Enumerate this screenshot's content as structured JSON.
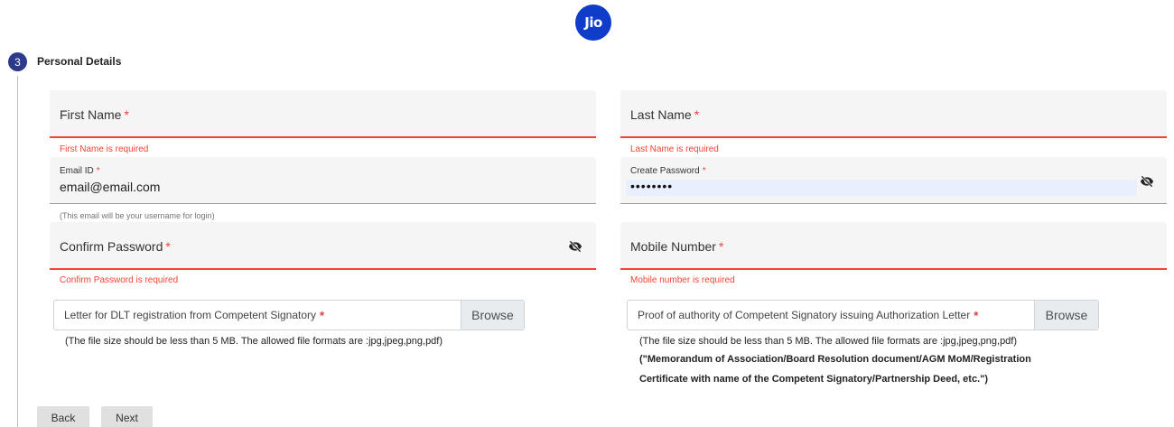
{
  "logo": {
    "text": "Jio"
  },
  "step": {
    "number": "3",
    "title": "Personal Details"
  },
  "form": {
    "first_name": {
      "label": "First Name",
      "required": "*",
      "error": "First Name is required"
    },
    "last_name": {
      "label": "Last Name",
      "required": "*",
      "error": "Last Name is required"
    },
    "email": {
      "label": "Email ID",
      "required": "*",
      "value": "email@email.com",
      "hint": "(This email will be your username for login)"
    },
    "create_password": {
      "label": "Create Password",
      "required": "*",
      "value": "••••••••"
    },
    "confirm_password": {
      "label": "Confirm Password",
      "required": "*",
      "error": "Confirm Password is required"
    },
    "mobile": {
      "label": "Mobile Number",
      "required": "*",
      "error": "Mobile number is required"
    }
  },
  "uploads": {
    "left": {
      "label": "Letter for DLT registration from Competent Signatory",
      "required": "*",
      "button": "Browse",
      "note": "(The file size should be less than 5 MB. The allowed file formats are :jpg,jpeg,png,pdf)"
    },
    "right": {
      "label": "Proof of authority of Competent Signatory issuing Authorization Letter",
      "required": "*",
      "button": "Browse",
      "note": "(The file size should be less than 5 MB. The allowed file formats are :jpg,jpeg,png,pdf)",
      "note_bold_1": "(\"Memorandum of Association/Board Resolution document/AGM MoM/Registration",
      "note_bold_2": "Certificate with name of the Competent Signatory/Partnership Deed, etc.\")"
    }
  },
  "buttons": {
    "back": "Back",
    "next": "Next"
  },
  "colors": {
    "brand": "#0f3cc9",
    "step_badge": "#2d3a8c",
    "error": "#f44336",
    "field_bg": "#f5f5f5"
  },
  "icons": {
    "password_toggle": "eye-slash-icon"
  }
}
